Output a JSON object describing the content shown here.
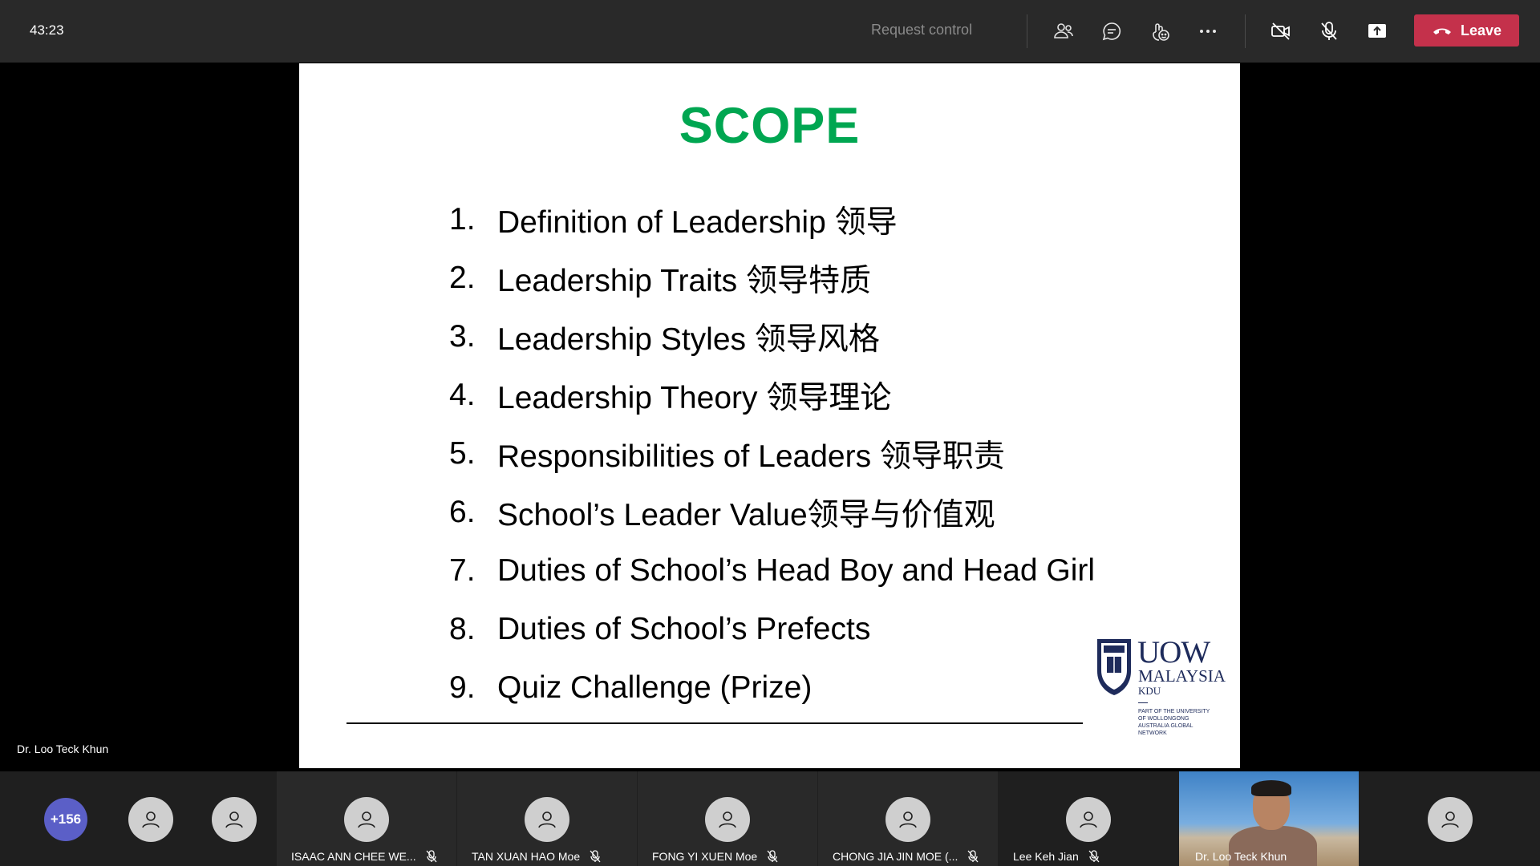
{
  "topbar": {
    "timer": "43:23",
    "request_control": "Request control",
    "leave_label": "Leave",
    "icons": [
      "people-icon",
      "chat-icon",
      "reactions-icon",
      "more-icon",
      "camera-off-icon",
      "mic-off-icon",
      "share-icon"
    ]
  },
  "stage": {
    "presenter_name": "Dr. Loo Teck Khun"
  },
  "slide": {
    "title": "SCOPE",
    "items": [
      {
        "num": "1.",
        "text": "Definition of Leadership 领导"
      },
      {
        "num": "2.",
        "text": "Leadership Traits 领导特质"
      },
      {
        "num": "3.",
        "text": "Leadership Styles 领导风格"
      },
      {
        "num": "4.",
        "text": "Leadership Theory 领导理论"
      },
      {
        "num": "5.",
        "text": "Responsibilities of Leaders 领导职责"
      },
      {
        "num": "6.",
        "text": "School’s Leader Value领导与价值观"
      },
      {
        "num": "7.",
        "text": "Duties of School’s Head Boy and Head Girl"
      },
      {
        "num": "8.",
        "text": "Duties of School’s Prefects"
      },
      {
        "num": "9.",
        "text": "Quiz Challenge (Prize)"
      }
    ],
    "logo": {
      "line1": "UOW",
      "line2": "MALAYSIA",
      "line3": "KDU",
      "network": "PART OF THE UNIVERSITY OF WOLLONGONG AUSTRALIA GLOBAL NETWORK"
    }
  },
  "participants": {
    "overflow_count": "+156",
    "tiles": [
      {
        "name": "ISAAC ANN CHEE WE..."
      },
      {
        "name": "TAN XUAN HAO Moe"
      },
      {
        "name": "FONG YI XUEN Moe"
      },
      {
        "name": "CHONG JIA JIN MOE (..."
      },
      {
        "name": "Lee Keh Jian"
      }
    ],
    "video_name": "Dr. Loo Teck Khun"
  },
  "colors": {
    "topbar": "#292929",
    "leave": "#c4314b",
    "title_green": "#00a651",
    "overflow": "#5b5fc7"
  }
}
